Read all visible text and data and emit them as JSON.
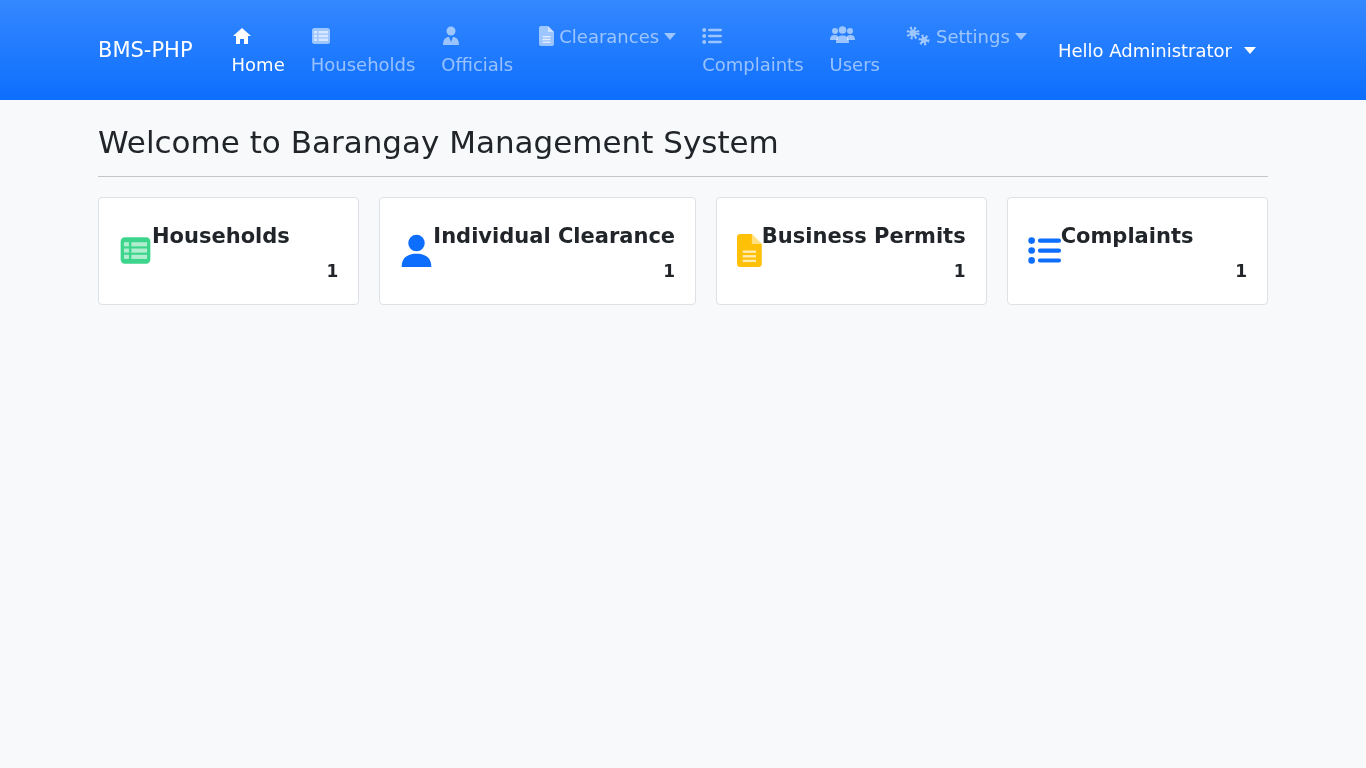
{
  "navbar": {
    "brand": "BMS-PHP",
    "items": [
      {
        "kind": "link",
        "label": "Home",
        "selected": true
      },
      {
        "kind": "link",
        "label": "Households",
        "selected": false
      },
      {
        "kind": "link",
        "label": "Officials",
        "selected": false
      },
      {
        "kind": "dropdown",
        "label": "Clearances",
        "selected": false
      },
      {
        "kind": "link",
        "label": "Complaints",
        "selected": false
      },
      {
        "kind": "link",
        "label": "Users",
        "selected": false
      },
      {
        "kind": "dropdown",
        "label": "Settings",
        "selected": false
      }
    ],
    "user_menu": "Hello Administrator"
  },
  "page_title": "Welcome to Barangay Management System",
  "cards": [
    {
      "title": "Households",
      "count": "1"
    },
    {
      "title": "Individual Clearance",
      "count": "1"
    },
    {
      "title": "Business Permits",
      "count": "1"
    },
    {
      "title": "Complaints",
      "count": "1"
    }
  ]
}
